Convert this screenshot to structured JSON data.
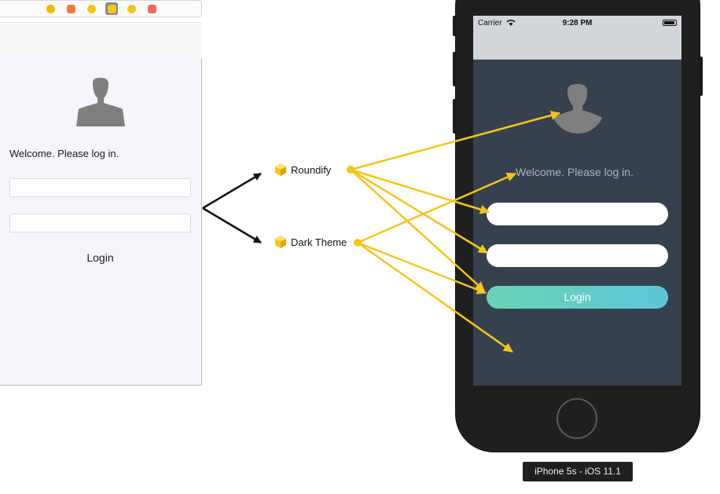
{
  "storyboard": {
    "toolbar": {
      "icons": [
        {
          "name": "view-controller-icon",
          "color": "#f5b800"
        },
        {
          "name": "first-responder-icon",
          "color": "#f07a3a"
        },
        {
          "name": "object-icon",
          "color": "#f5c518"
        },
        {
          "name": "mixin-cube-icon-selected",
          "color": "#f5c518"
        },
        {
          "name": "mixin-cube-icon",
          "color": "#f5c518"
        },
        {
          "name": "exit-icon",
          "color": "#ef6a5a"
        }
      ]
    },
    "welcome": "Welcome. Please log in.",
    "login_label": "Login"
  },
  "mixins": {
    "roundify": "Roundify",
    "dark_theme": "Dark Theme"
  },
  "phone": {
    "status": {
      "carrier": "Carrier",
      "time": "9:28 PM"
    },
    "welcome": "Welcome. Please log in.",
    "login_label": "Login"
  },
  "device_label": "iPhone 5s - iOS 11.1",
  "colors": {
    "arrow_yellow": "#f5c518",
    "arrow_black": "#111111",
    "screen_dark": "#36414f",
    "login_gradient_start": "#6ad3b4",
    "login_gradient_end": "#5dc6d8"
  }
}
